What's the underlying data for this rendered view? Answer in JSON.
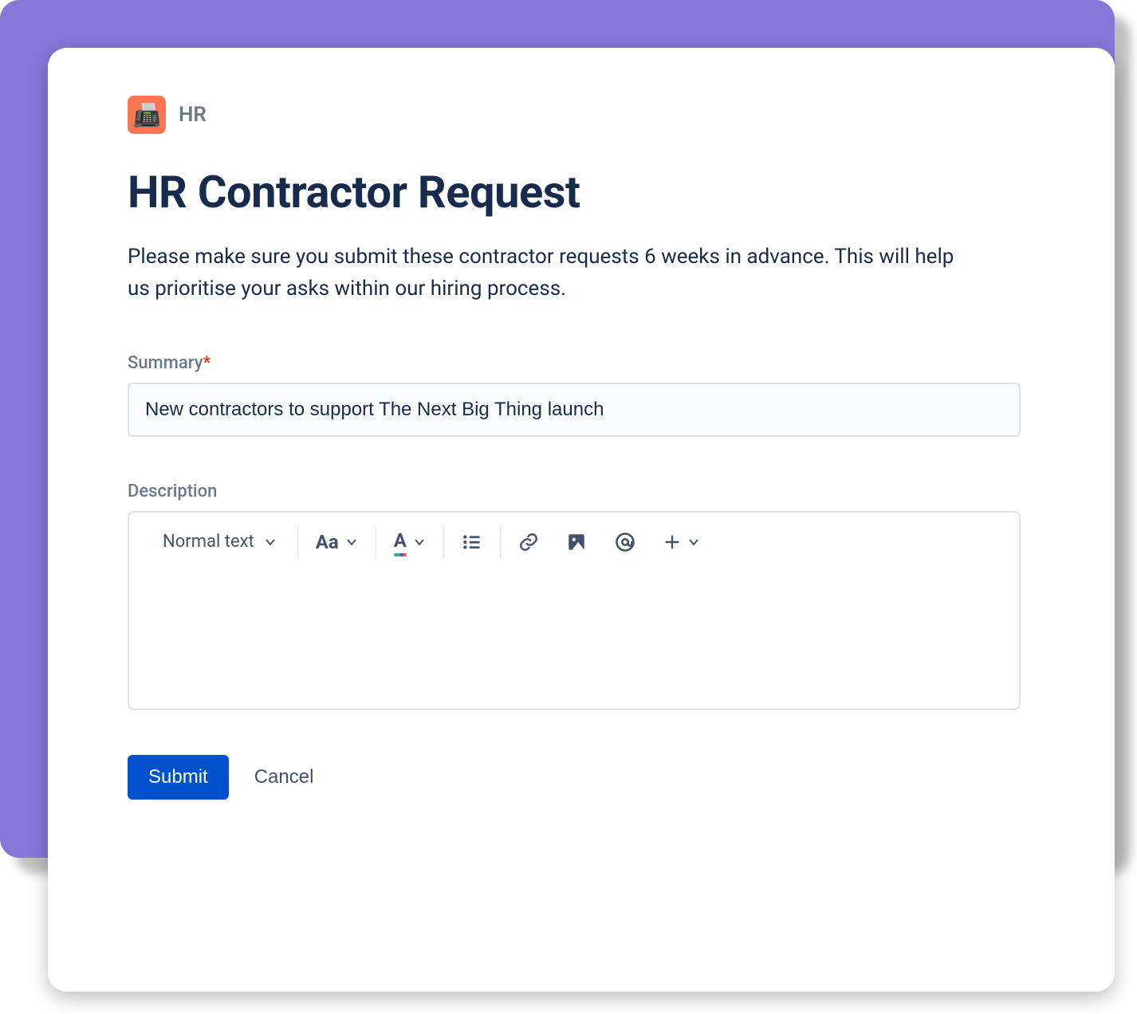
{
  "project": {
    "name": "HR",
    "icon_emoji": "📠"
  },
  "form": {
    "title": "HR Contractor Request",
    "description": "Please make sure you submit these contractor requests 6 weeks in advance. This will help us prioritise your asks within our hiring process.",
    "fields": {
      "summary": {
        "label": "Summary",
        "required": true,
        "value": "New contractors to support The Next Big Thing launch"
      },
      "description": {
        "label": "Description",
        "value": ""
      }
    },
    "editor_toolbar": {
      "text_style": "Normal text"
    },
    "actions": {
      "submit": "Submit",
      "cancel": "Cancel"
    }
  }
}
